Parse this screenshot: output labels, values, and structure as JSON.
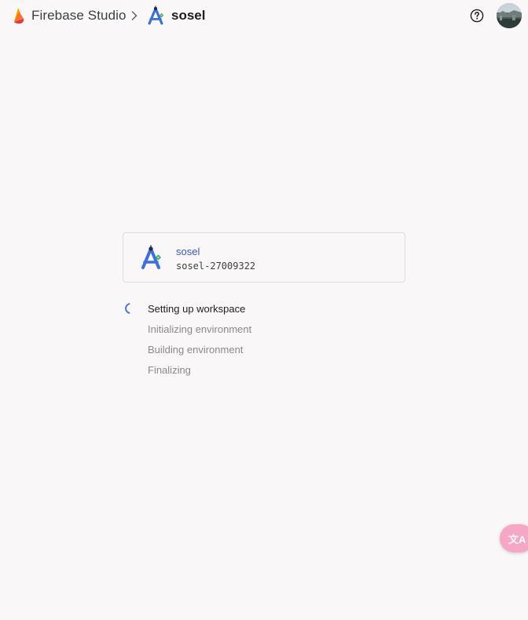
{
  "header": {
    "brand": "Firebase Studio",
    "breadcrumb_separator": ">",
    "project_name": "sosel",
    "icons": {
      "brand": "firebase-flame-icon",
      "project": "android-studio-app-icon",
      "help": "help-circle-icon",
      "avatar": "user-avatar"
    }
  },
  "workspace_card": {
    "title": "sosel",
    "subtitle": "sosel-27009322",
    "icon": "android-studio-app-icon"
  },
  "setup_steps": [
    {
      "label": "Setting up workspace",
      "state": "active"
    },
    {
      "label": "Initializing environment",
      "state": "pending"
    },
    {
      "label": "Building environment",
      "state": "pending"
    },
    {
      "label": "Finalizing",
      "state": "pending"
    }
  ],
  "translate_button": {
    "label": "文A",
    "icon": "translate-icon"
  },
  "colors": {
    "background": "#f9f7f8",
    "link_blue": "#3b54c4",
    "spinner_blue": "#4c78d8",
    "pending_text": "#8a8a8e",
    "translate_fab": "#f6a7c5"
  }
}
